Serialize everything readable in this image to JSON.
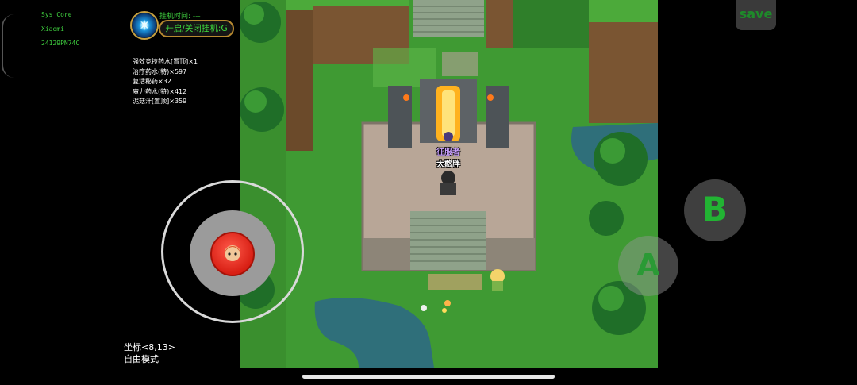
{
  "sysinfo": {
    "line1": "Sys Core",
    "line2": "Xiaomi",
    "line3": "24129PN74C"
  },
  "idle": {
    "time_label": "挂机时间: ---",
    "toggle_label": "开启/关闭挂机:G",
    "emblem_icon": "magic-emblem-icon"
  },
  "inventory": [
    "强效竞技药水[置顶]×1",
    "治疗药水(特)×597",
    "复活秘药×32",
    "魔力药水(特)×412",
    "泥菇汁[置顶]×359"
  ],
  "character": {
    "title": "征服者",
    "name": "太憨胖"
  },
  "coords": {
    "label": "坐标<8,13>",
    "mode": "自由模式"
  },
  "buttons": {
    "save": "save",
    "b": "B",
    "a": "A"
  },
  "colors": {
    "hud_green": "#3fcf3f",
    "grass": "#3f9a33",
    "portal": "#ffb21e"
  }
}
